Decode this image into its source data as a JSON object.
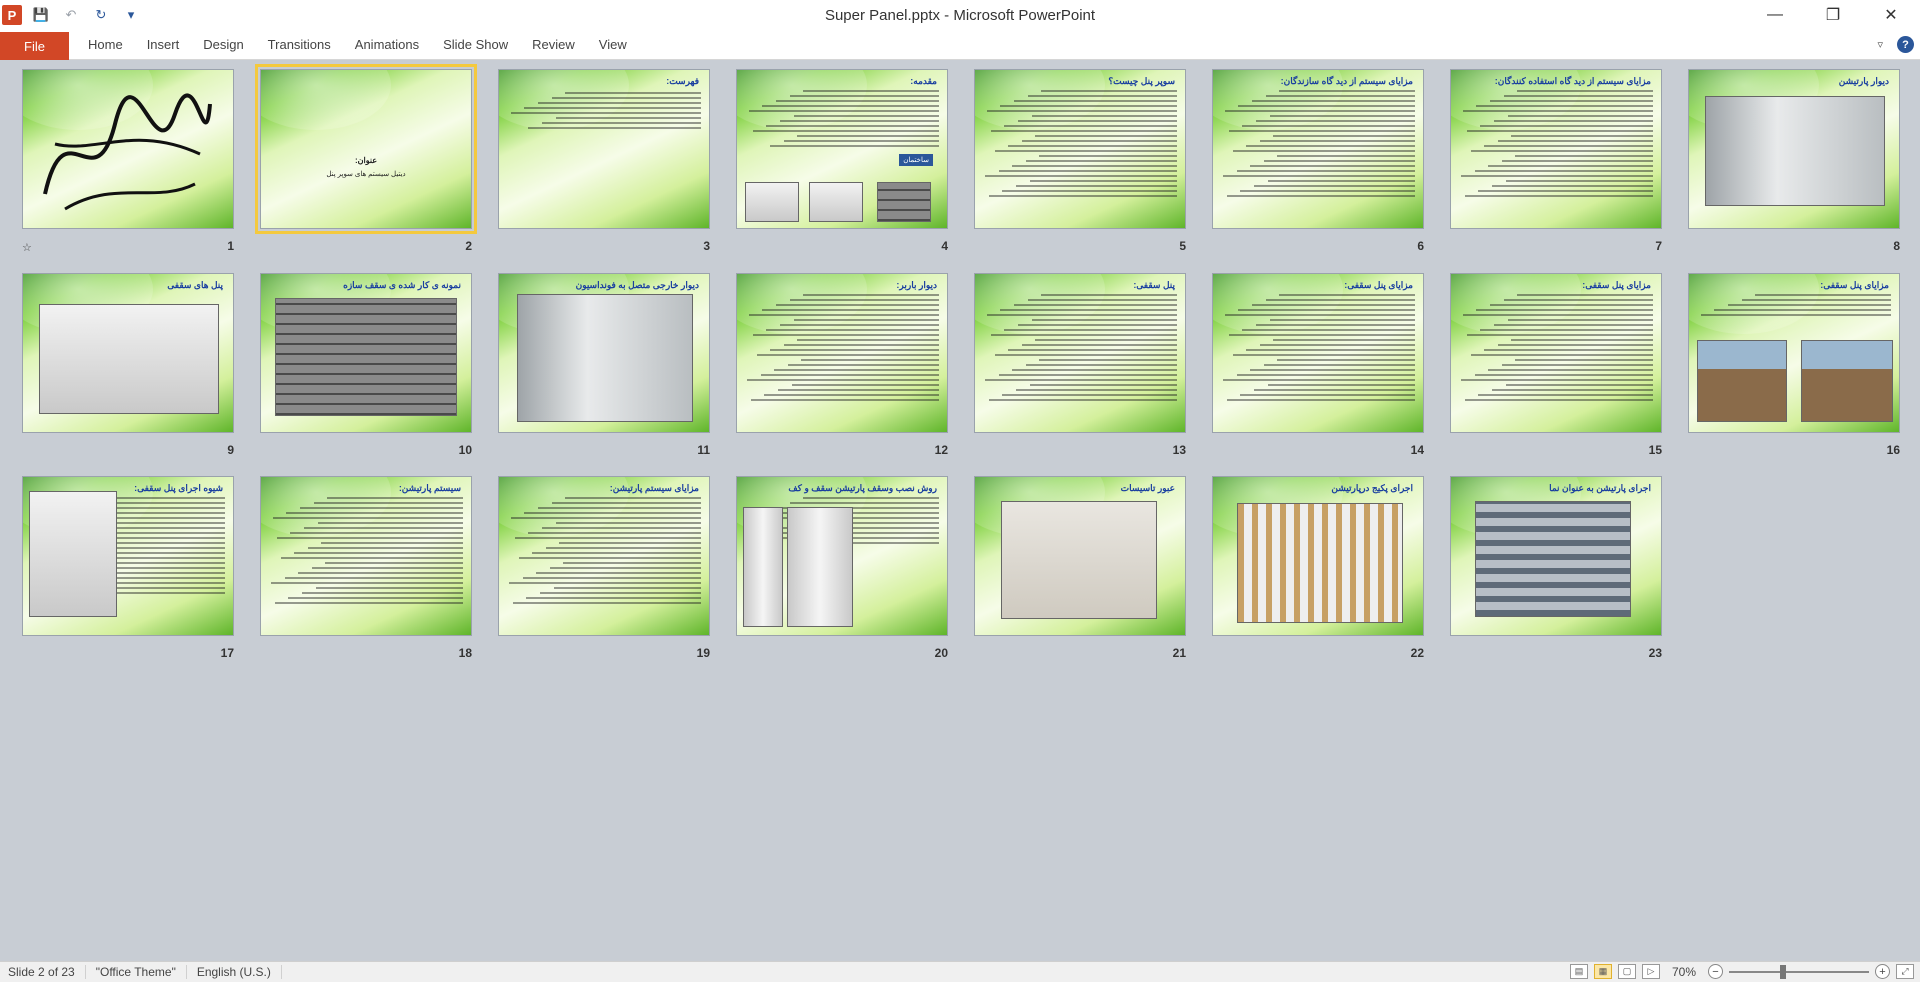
{
  "window": {
    "title": "Super Panel.pptx - Microsoft PowerPoint",
    "app_icon": "P",
    "qat": [
      {
        "name": "save-icon",
        "glyph": "💾"
      },
      {
        "name": "undo-icon",
        "glyph": "↶"
      },
      {
        "name": "redo-icon",
        "glyph": "↻"
      },
      {
        "name": "customize-qat-icon",
        "glyph": "▾"
      }
    ],
    "controls": [
      {
        "name": "minimize-button",
        "glyph": "—"
      },
      {
        "name": "restore-button",
        "glyph": "❐"
      },
      {
        "name": "close-button",
        "glyph": "✕"
      }
    ]
  },
  "ribbon": {
    "file_label": "File",
    "tabs": [
      "Home",
      "Insert",
      "Design",
      "Transitions",
      "Animations",
      "Slide Show",
      "Review",
      "View"
    ],
    "help_glyph": "?",
    "collapse_glyph": "▿"
  },
  "slides": [
    {
      "num": "1",
      "title": "",
      "kind": "calligraphy"
    },
    {
      "num": "2",
      "title": "عنوان:",
      "subtitle": "دیتیل سیستم های سوپر پنل",
      "kind": "title"
    },
    {
      "num": "3",
      "title": "فهرست:",
      "kind": "list"
    },
    {
      "num": "4",
      "title": "مقدمه:",
      "kind": "text-pics",
      "callout": "ساختمان"
    },
    {
      "num": "5",
      "title": "سوپر پنل چیست؟",
      "kind": "text"
    },
    {
      "num": "6",
      "title": "مزایای سیستم از دید گاه سازندگان:",
      "kind": "text"
    },
    {
      "num": "7",
      "title": "مزایای سیستم از دید گاه استفاده کنندگان:",
      "kind": "text"
    },
    {
      "num": "8",
      "title": "دیوار پارتیشن",
      "kind": "wall"
    },
    {
      "num": "9",
      "title": "پنل های سقفی",
      "kind": "slab"
    },
    {
      "num": "10",
      "title": "نمونه ی کار شده ی سقف سازه",
      "kind": "rebar"
    },
    {
      "num": "11",
      "title": "دیوار خارجی متصل به فونداسیون",
      "kind": "wall3d"
    },
    {
      "num": "12",
      "title": "دیوار باربر:",
      "kind": "text"
    },
    {
      "num": "13",
      "title": "پنل سقفی:",
      "kind": "text"
    },
    {
      "num": "14",
      "title": "مزایای پنل سقفی:",
      "kind": "text"
    },
    {
      "num": "15",
      "title": "مزایای پنل سقفی:",
      "kind": "text"
    },
    {
      "num": "16",
      "title": "مزایای پنل سقفی:",
      "kind": "text-site"
    },
    {
      "num": "17",
      "title": "شیوه اجرای پنل سقفی:",
      "kind": "diagram"
    },
    {
      "num": "18",
      "title": "سیستم پارتیشن:",
      "kind": "text"
    },
    {
      "num": "19",
      "title": "مزایای سیستم پارتیشن:",
      "kind": "text"
    },
    {
      "num": "20",
      "title": "روش نصب وسقف پارتیشن سقف و کف",
      "kind": "corridor"
    },
    {
      "num": "21",
      "title": "عبور تاسیسات",
      "kind": "panel"
    },
    {
      "num": "22",
      "title": "اجرای پکیج درپارتیشن",
      "kind": "install"
    },
    {
      "num": "23",
      "title": "اجرای پارتیشن به عنوان نما",
      "kind": "building"
    }
  ],
  "status": {
    "slide_info": "Slide 2 of 23",
    "theme": "\"Office Theme\"",
    "language": "English (U.S.)",
    "zoom": "70%",
    "zoom_fraction": 0.38
  }
}
